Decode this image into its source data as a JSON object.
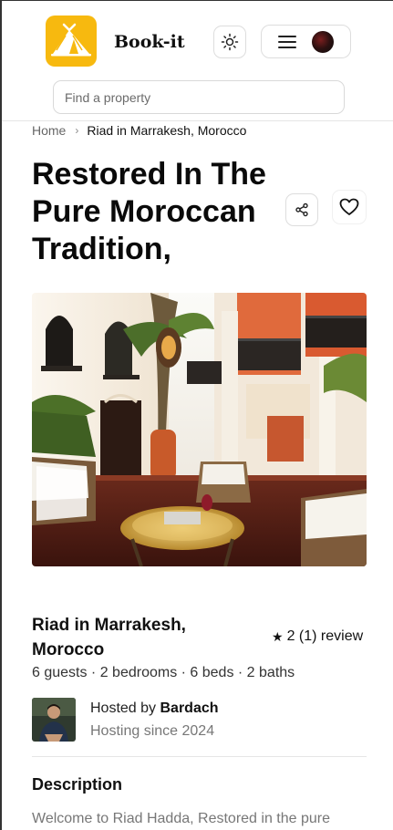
{
  "header": {
    "brand": "Book-it",
    "theme_icon": "sun-icon",
    "menu_icon": "hamburger-icon",
    "logo_icon": "tent-icon"
  },
  "search": {
    "placeholder": "Find a property",
    "value": ""
  },
  "breadcrumb": {
    "home": "Home",
    "separator": "›",
    "current": "Riad in Marrakesh, Morocco"
  },
  "listing": {
    "title": "Restored In The Pure Moroccan Tradition,",
    "share_icon": "share-icon",
    "favorite_icon": "heart-icon",
    "property_name": "Riad in Marrakesh, Morocco",
    "rating": {
      "star": "★",
      "text": "2 (1) review"
    },
    "specs": "6 guests · 2 bedrooms · 6 beds · 2 baths"
  },
  "host": {
    "prefix": "Hosted by ",
    "name": "Bardach",
    "since": "Hosting since 2024"
  },
  "description": {
    "heading": "Description",
    "text": "Welcome to Riad Hadda, Restored in the pure"
  },
  "colors": {
    "brand_yellow": "#f7b90f",
    "text_dark": "#111111",
    "muted": "#777777",
    "border": "#dddddd"
  }
}
